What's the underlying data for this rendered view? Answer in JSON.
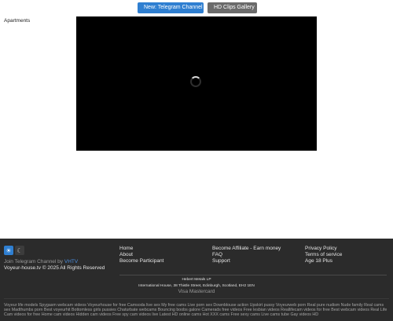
{
  "topbar": {
    "telegram_label": "New: Telegram Channel",
    "hd_label": "HD Clips Gallery"
  },
  "category": "Apartments",
  "footer": {
    "join_text": "Join Telegram Channel by",
    "join_link": "VHTV",
    "copyright": "Voyeur-house.tv © 2025 All Rights Reserved",
    "col1": [
      "Home",
      "About",
      "Become Participant"
    ],
    "col2": [
      "Become Affiliate - Earn money",
      "FAQ",
      "Support"
    ],
    "col3": [
      "Privacy Policy",
      "Terms of service",
      "Age 18 Plus"
    ],
    "company_name": "Hebert Metals LP",
    "company_address": "International House, 38 Thistle Street, Edinburgh, Scotland, EH2 1EN",
    "payments": "Visa   Mastercard",
    "seo_text": "Voyeur life models Spygasm webcam videos Voyeurhouse for free Camsoda live sex My free cams Live porn sex Downblouse action Upskirt pussy Voyeurweb porn Real pure nudism Nude family Real cams sex Madthumbs porn Best voyeurhit Bottomless girls pussies Chaturbate webcams Bouncing boobs galore Camerads free videos Free lesbian videos Reallifecam videos for free Best webcam videos Real Life Cam videos for free Home cam videos Hidden cam videos Free spy cam videos live Latest HD online cams Hot XXX cams Free sexy cams Live cams tube Gay videos HD"
  },
  "colors": {
    "accent": "#2f7fd1",
    "footer_bg": "#2b2b2b"
  }
}
